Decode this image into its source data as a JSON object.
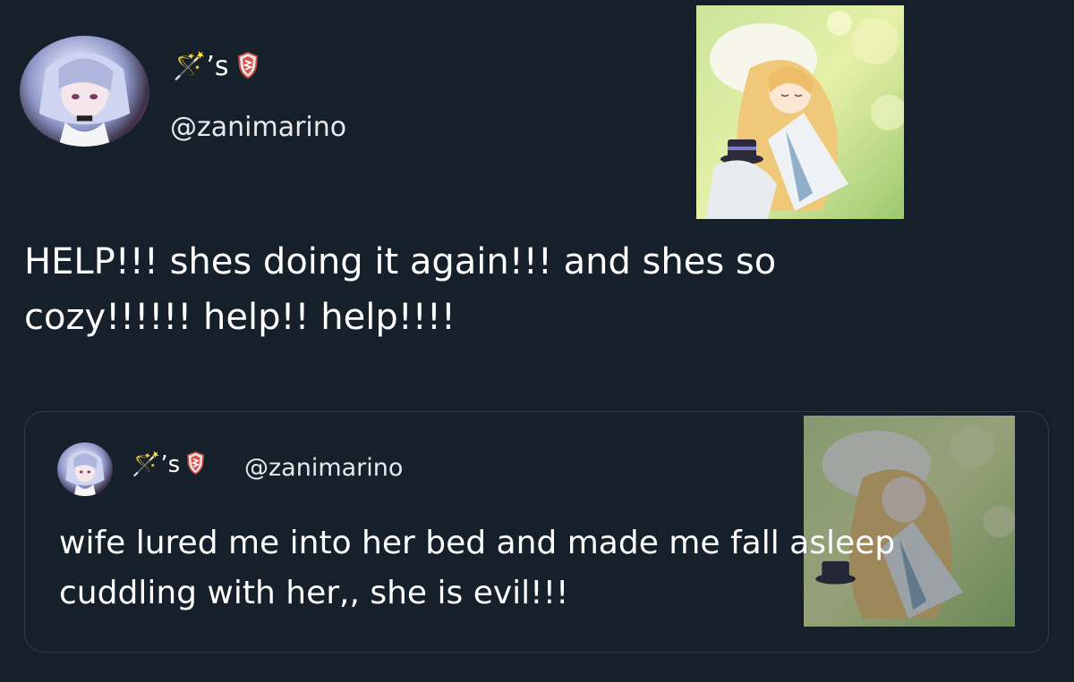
{
  "main_tweet": {
    "author": {
      "display_name": "🪄’s",
      "badge_icon": "shield-icon",
      "handle": "@zanimarino"
    },
    "text": "HELP!!! shes doing it again!!! and shes so cozy!!!!!! help!! help!!!!"
  },
  "quoted_tweet": {
    "author": {
      "display_name": "🪄’s",
      "badge_icon": "shield-icon",
      "handle": "@zanimarino"
    },
    "text": "wife lured me into her bed and made me fall asleep cuddling with her,, she is evil!!!"
  },
  "colors": {
    "background": "#15202b",
    "text": "#ffffff",
    "card_border": "#2f3d4a",
    "shield": "#d9534f"
  }
}
